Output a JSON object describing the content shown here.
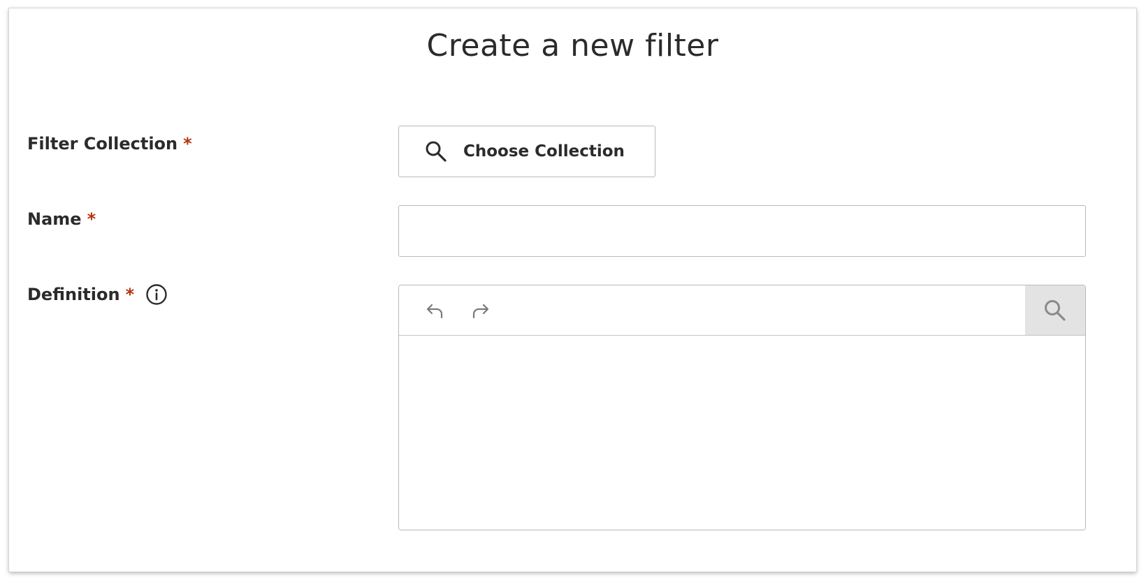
{
  "dialog": {
    "title": "Create a new filter"
  },
  "form": {
    "filter_collection": {
      "label": "Filter Collection",
      "required_marker": "*",
      "button_label": "Choose Collection",
      "button_icon": "search-icon"
    },
    "name": {
      "label": "Name",
      "required_marker": "*",
      "value": "",
      "placeholder": ""
    },
    "definition": {
      "label": "Definition",
      "required_marker": "*",
      "info_icon": "info-icon",
      "toolbar": {
        "undo_icon": "undo-icon",
        "redo_icon": "redo-icon",
        "search_icon": "search-icon"
      },
      "value": ""
    }
  },
  "colors": {
    "required": "#b3330f",
    "text": "#2b2b2b",
    "border": "#b9b9b9",
    "toolbar_search_bg": "#e3e3e3",
    "icon_muted": "#7a7a7a"
  }
}
